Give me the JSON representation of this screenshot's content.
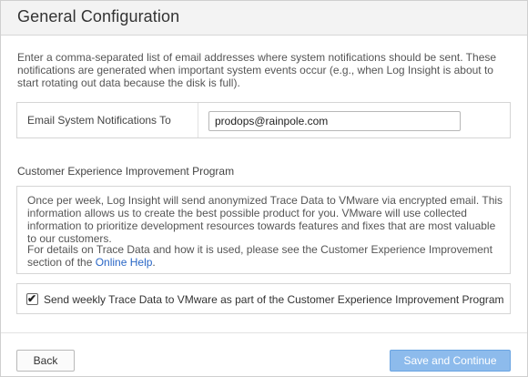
{
  "header": {
    "title": "General Configuration"
  },
  "intro": {
    "text": "Enter a comma-separated list of email addresses where system notifications should be sent. These notifications are generated when important system events occur (e.g., when Log Insight is about to start rotating out data because the disk is full)."
  },
  "email": {
    "label": "Email System Notifications To",
    "value": "prodops@rainpole.com"
  },
  "ceip": {
    "title": "Customer Experience Improvement Program",
    "paragraph1": "Once per week, Log Insight will send anonymized Trace Data to VMware via encrypted email. This information allows us to create the best possible product for you. VMware will use collected information to prioritize development resources towards features and fixes that are most valuable to our customers.",
    "paragraph2_before": "For details on Trace Data and how it is used, please see the Customer Experience Improvement section of the ",
    "paragraph2_link": "Online Help",
    "paragraph2_after": ".",
    "checkbox_label": "Send weekly Trace Data to VMware as part of the Customer Experience Improvement Program",
    "checkbox_checked": true,
    "checkmark_glyph": "✔"
  },
  "footer": {
    "back_label": "Back",
    "save_label": "Save and Continue"
  },
  "colors": {
    "link": "#2a67c6",
    "primary_button": "#8dbbec"
  }
}
